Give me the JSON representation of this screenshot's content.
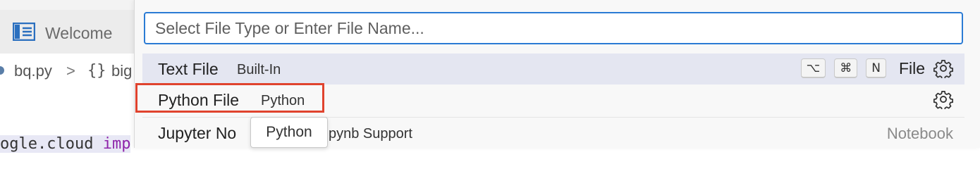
{
  "editor": {
    "tab_label": "Welcome",
    "breadcrumb": {
      "file": "bq.py",
      "separator": ">",
      "symbol_icon": "{}",
      "symbol_name": "big"
    },
    "code_snippet": {
      "plain": "ogle.cloud ",
      "keyword": "imp"
    }
  },
  "picker": {
    "search": {
      "value": "",
      "placeholder": "Select File Type or Enter File Name..."
    },
    "items": [
      {
        "title": "Text File",
        "description": "Built-In",
        "keybinding": [
          "⌥",
          "⌘",
          "N"
        ],
        "keybinding_label": "File",
        "action_icon": "gear-icon"
      },
      {
        "title": "Python File",
        "description": "Python",
        "action_icon": "gear-icon"
      },
      {
        "title": "Jupyter No",
        "detail": "pynb Support",
        "kind": "Notebook"
      }
    ],
    "tooltip": "Python"
  },
  "colors": {
    "focus_border": "#2b7bd4",
    "selection_bg": "#e4e6f1",
    "annotation_red": "#e0432e"
  }
}
